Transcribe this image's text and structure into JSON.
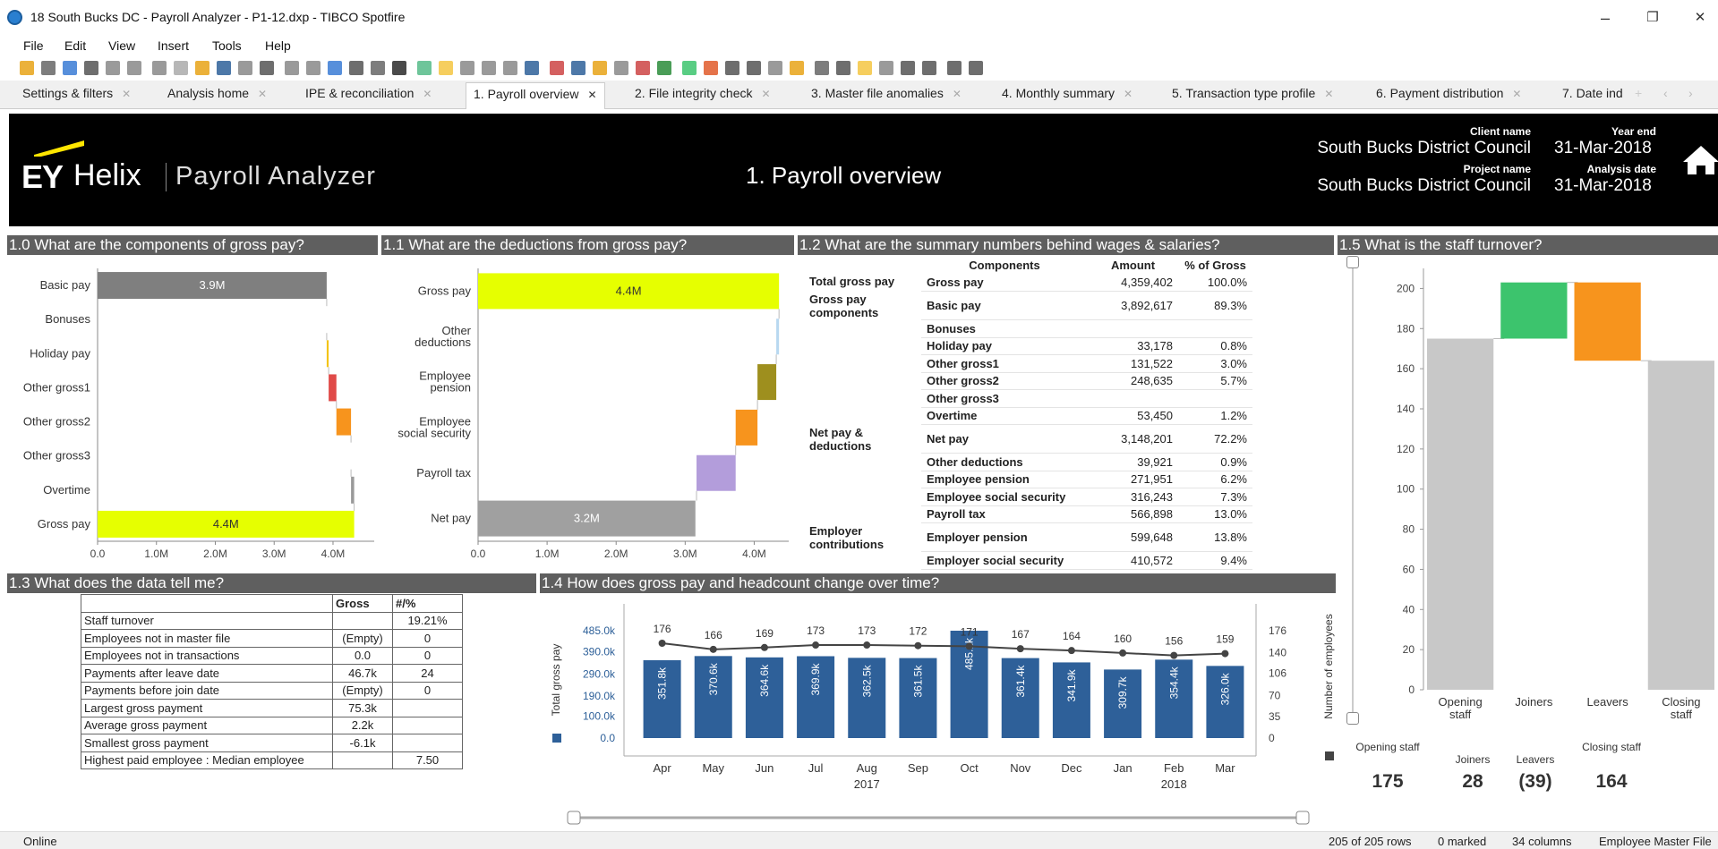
{
  "window": {
    "title": "18 South Bucks DC - Payroll Analyzer - P1-12.dxp - TIBCO Spotfire",
    "minimize": "–",
    "restore": "❐",
    "close": "✕"
  },
  "menu": [
    "File",
    "Edit",
    "View",
    "Insert",
    "Tools",
    "Help"
  ],
  "tabs": [
    {
      "label": "Settings & filters"
    },
    {
      "label": "Analysis home"
    },
    {
      "label": "IPE & reconciliation"
    },
    {
      "label": "1. Payroll overview"
    },
    {
      "label": "2. File integrity check"
    },
    {
      "label": "3. Master file anomalies"
    },
    {
      "label": "4. Monthly summary"
    },
    {
      "label": "5. Transaction type profile"
    },
    {
      "label": "6. Payment distribution"
    },
    {
      "label": "7. Date ind"
    }
  ],
  "banner": {
    "logo_ey": "EY",
    "logo_helix": "Helix",
    "logo_product": "Payroll Analyzer",
    "page_title": "1. Payroll overview",
    "client_label": "Client name",
    "client_value": "South Bucks District Council",
    "yearend_label": "Year end",
    "yearend_value": "31-Mar-2018",
    "project_label": "Project name",
    "project_value": "South Bucks District Council",
    "analysis_label": "Analysis date",
    "analysis_value": "31-Mar-2018"
  },
  "sections": {
    "s10": "1.0 What are the components of gross pay?",
    "s11": "1.1 What are the deductions from gross pay?",
    "s12": "1.2 What are the summary numbers behind wages & salaries?",
    "s15": "1.5 What is the staff turnover?",
    "s13": "1.3 What does the data tell me?",
    "s14": "1.4 How does gross pay and headcount change over time?"
  },
  "chart_data": [
    {
      "type": "bar",
      "orientation": "horizontal-waterfall",
      "categories": [
        "Basic pay",
        "Bonuses",
        "Holiday pay",
        "Other gross1",
        "Other gross2",
        "Other gross3",
        "Overtime",
        "Gross pay"
      ],
      "values": [
        3892617,
        0,
        33178,
        131522,
        248635,
        0,
        53450,
        4359402
      ],
      "bar_labels": [
        "3.9M",
        "",
        "",
        "",
        "",
        "",
        "",
        "4.4M"
      ],
      "colors": [
        "#7f7f7f",
        "#7f7f7f",
        "#f3c419",
        "#e04a48",
        "#f7941d",
        "#7f7f7f",
        "#9a9a9a",
        "#e6ff00"
      ],
      "xticks": [
        "0.0",
        "1.0M",
        "2.0M",
        "3.0M",
        "4.0M"
      ],
      "xlim": [
        0,
        4700000
      ]
    },
    {
      "type": "bar",
      "orientation": "horizontal-waterfall",
      "categories": [
        "Gross pay",
        "Other deductions",
        "Employee pension",
        "Employee social security",
        "Payroll tax",
        "Net pay"
      ],
      "values": [
        4359402,
        39921,
        271951,
        316243,
        566898,
        3148201
      ],
      "bar_labels": [
        "4.4M",
        "",
        "",
        "",
        "",
        "3.2M"
      ],
      "colors": [
        "#e6ff00",
        "#b8d8f0",
        "#9e8f1e",
        "#f7941d",
        "#b39ddb",
        "#a0a0a0"
      ],
      "xticks": [
        "0.0",
        "1.0M",
        "2.0M",
        "3.0M",
        "4.0M"
      ],
      "xlim": [
        0,
        4500000
      ]
    },
    {
      "type": "bar",
      "orientation": "waterfall",
      "categories": [
        "Opening staff",
        "Joiners",
        "Leavers",
        "Closing staff"
      ],
      "values": [
        175,
        28,
        -39,
        164
      ],
      "colors": [
        "#c8c8c8",
        "#3cc46d",
        "#f7941d",
        "#c8c8c8"
      ],
      "yticks": [
        0,
        20,
        40,
        60,
        80,
        100,
        120,
        140,
        160,
        180,
        200
      ],
      "ylim": [
        0,
        210
      ]
    },
    {
      "type": "bar",
      "categories": [
        "Apr",
        "May",
        "Jun",
        "Jul",
        "Aug",
        "Sep",
        "Oct",
        "Nov",
        "Dec",
        "Jan",
        "Feb",
        "Mar"
      ],
      "years": [
        "2017",
        "2018"
      ],
      "series": [
        {
          "name": "Total gross pay",
          "values": [
            351.8,
            370.6,
            364.6,
            369.9,
            362.5,
            361.5,
            485.1,
            361.4,
            341.9,
            309.7,
            354.4,
            326.0
          ],
          "bar_labels": [
            "351.8k",
            "370.6k",
            "364.6k",
            "369.9k",
            "362.5k",
            "361.5k",
            "485.1k",
            "361.4k",
            "341.9k",
            "309.7k",
            "354.4k",
            "326.0k"
          ],
          "color": "#2e6099"
        },
        {
          "name": "Number of employees",
          "values": [
            176,
            166,
            169,
            173,
            173,
            172,
            171,
            167,
            164,
            160,
            156,
            159
          ],
          "color": "#444444"
        }
      ],
      "yticks_left": [
        "0.0",
        "100.0k",
        "190.0k",
        "290.0k",
        "390.0k",
        "485.0k"
      ],
      "yticks_right": [
        "0",
        "35",
        "70",
        "106",
        "140",
        "176"
      ],
      "ylabel": "Total gross pay",
      "y2label": "Number of employees"
    }
  ],
  "summary_table": {
    "headers": [
      "Components",
      "Amount",
      "% of Gross"
    ],
    "rows": [
      {
        "group": "Total gross pay",
        "comp": "Gross pay",
        "amount": "4,359,402",
        "pct": "100.0%"
      },
      {
        "group": "Gross pay components",
        "comp": "Basic pay",
        "amount": "3,892,617",
        "pct": "89.3%"
      },
      {
        "group": "",
        "comp": "Bonuses",
        "amount": "",
        "pct": ""
      },
      {
        "group": "",
        "comp": "Holiday pay",
        "amount": "33,178",
        "pct": "0.8%"
      },
      {
        "group": "",
        "comp": "Other gross1",
        "amount": "131,522",
        "pct": "3.0%"
      },
      {
        "group": "",
        "comp": "Other gross2",
        "amount": "248,635",
        "pct": "5.7%"
      },
      {
        "group": "",
        "comp": "Other gross3",
        "amount": "",
        "pct": ""
      },
      {
        "group": "",
        "comp": "Overtime",
        "amount": "53,450",
        "pct": "1.2%"
      },
      {
        "group": "Net pay & deductions",
        "comp": "Net pay",
        "amount": "3,148,201",
        "pct": "72.2%"
      },
      {
        "group": "",
        "comp": "Other deductions",
        "amount": "39,921",
        "pct": "0.9%"
      },
      {
        "group": "",
        "comp": "Employee pension",
        "amount": "271,951",
        "pct": "6.2%"
      },
      {
        "group": "",
        "comp": "Employee social security",
        "amount": "316,243",
        "pct": "7.3%"
      },
      {
        "group": "",
        "comp": "Payroll tax",
        "amount": "566,898",
        "pct": "13.0%"
      },
      {
        "group": "Employer contributions",
        "comp": "Employer pension",
        "amount": "599,648",
        "pct": "13.8%"
      },
      {
        "group": "",
        "comp": "Employer social security",
        "amount": "410,572",
        "pct": "9.4%"
      }
    ]
  },
  "data_table": {
    "headers": [
      "",
      "Gross",
      "#/%"
    ],
    "rows": [
      [
        "Staff turnover",
        "",
        "19.21%"
      ],
      [
        "Employees not in master file",
        "(Empty)",
        "0"
      ],
      [
        "Employees not in transactions",
        "0.0",
        "0"
      ],
      [
        "Payments after leave date",
        "46.7k",
        "24"
      ],
      [
        "Payments before join date",
        "(Empty)",
        "0"
      ],
      [
        "Largest gross payment",
        "75.3k",
        ""
      ],
      [
        "Average gross payment",
        "2.2k",
        ""
      ],
      [
        "Smallest gross payment",
        "-6.1k",
        ""
      ],
      [
        "Highest paid employee : Median employee",
        "",
        "7.50"
      ]
    ]
  },
  "turnover_summary": {
    "labels": [
      "Opening staff",
      "Joiners",
      "Leavers",
      "Closing staff"
    ],
    "values": [
      "175",
      "28",
      "(39)",
      "164"
    ]
  },
  "status": {
    "left": "Online",
    "rows": "205 of 205 rows",
    "marked": "0 marked",
    "columns": "34 columns",
    "table": "Employee Master File"
  }
}
